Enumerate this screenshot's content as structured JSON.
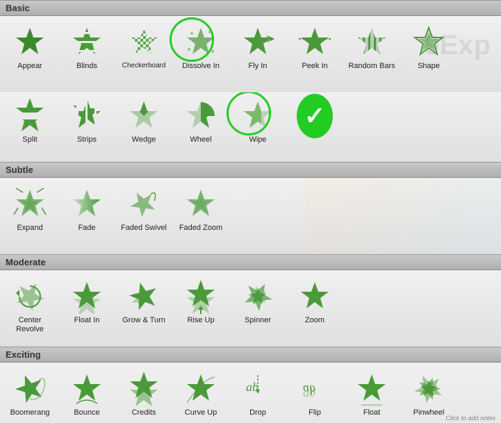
{
  "sections": [
    {
      "id": "basic",
      "label": "Basic",
      "items": [
        {
          "id": "appear",
          "label": "Appear",
          "type": "star",
          "variant": "solid"
        },
        {
          "id": "blinds",
          "label": "Blinds",
          "type": "star",
          "variant": "lines"
        },
        {
          "id": "checkerboard",
          "label": "Checker­board",
          "type": "star",
          "variant": "checker"
        },
        {
          "id": "dissolve-in",
          "label": "Dissolve In",
          "type": "star",
          "variant": "dotted",
          "circled": true
        },
        {
          "id": "fly-in",
          "label": "Fly In",
          "type": "star",
          "variant": "streak"
        },
        {
          "id": "peek-in",
          "label": "Peek In",
          "type": "star",
          "variant": "dash"
        },
        {
          "id": "random-bars",
          "label": "Random Bars",
          "type": "star",
          "variant": "dash2"
        },
        {
          "id": "shape",
          "label": "Shape",
          "type": "star",
          "variant": "outline"
        }
      ]
    },
    {
      "id": "basic-row2",
      "items": [
        {
          "id": "split",
          "label": "Split",
          "type": "star",
          "variant": "split"
        },
        {
          "id": "strips",
          "label": "Strips",
          "type": "star",
          "variant": "strips"
        },
        {
          "id": "wedge",
          "label": "Wedge",
          "type": "star",
          "variant": "wedge"
        },
        {
          "id": "wheel",
          "label": "Wheel",
          "type": "star",
          "variant": "wheel"
        },
        {
          "id": "wipe",
          "label": "Wipe",
          "type": "star",
          "variant": "wipe",
          "circled": true
        },
        {
          "id": "checkmark",
          "label": "",
          "type": "checkmark"
        }
      ]
    },
    {
      "id": "subtle",
      "label": "Subtle",
      "items": [
        {
          "id": "expand",
          "label": "Expand",
          "type": "star",
          "variant": "expand"
        },
        {
          "id": "fade",
          "label": "Fade",
          "type": "star",
          "variant": "fade"
        },
        {
          "id": "faded-swivel",
          "label": "Faded Swivel",
          "type": "star",
          "variant": "swivel"
        },
        {
          "id": "faded-zoom",
          "label": "Faded Zoom",
          "type": "star",
          "variant": "zoom-fade"
        }
      ]
    },
    {
      "id": "moderate",
      "label": "Moderate",
      "items": [
        {
          "id": "center-revolve",
          "label": "Center Revolve",
          "type": "star",
          "variant": "revolve"
        },
        {
          "id": "float-in",
          "label": "Float In",
          "type": "star",
          "variant": "float"
        },
        {
          "id": "grow-turn",
          "label": "Grow & Turn",
          "type": "star",
          "variant": "grow"
        },
        {
          "id": "rise-up",
          "label": "Rise Up",
          "type": "star",
          "variant": "rise"
        },
        {
          "id": "spinner",
          "label": "Spinner",
          "type": "star",
          "variant": "spinner"
        },
        {
          "id": "zoom",
          "label": "Zoom",
          "type": "star",
          "variant": "zoom"
        }
      ]
    },
    {
      "id": "exciting",
      "label": "Exciting",
      "items": [
        {
          "id": "boomerang",
          "label": "Boomerang",
          "type": "star",
          "variant": "boomerang"
        },
        {
          "id": "bounce",
          "label": "Bounce",
          "type": "star",
          "variant": "bounce"
        },
        {
          "id": "credits",
          "label": "Credits",
          "type": "star",
          "variant": "credits"
        },
        {
          "id": "curve-up",
          "label": "Curve Up",
          "type": "star",
          "variant": "curve"
        },
        {
          "id": "drop",
          "label": "Drop",
          "type": "text-star",
          "variant": "drop"
        },
        {
          "id": "flip",
          "label": "Flip",
          "type": "text-star",
          "variant": "flip"
        },
        {
          "id": "float2",
          "label": "Float",
          "type": "star",
          "variant": "float2"
        },
        {
          "id": "pinwheel",
          "label": "Pinwheel",
          "type": "star",
          "variant": "pinwheel"
        }
      ]
    }
  ],
  "click_note": "Click to add notes"
}
